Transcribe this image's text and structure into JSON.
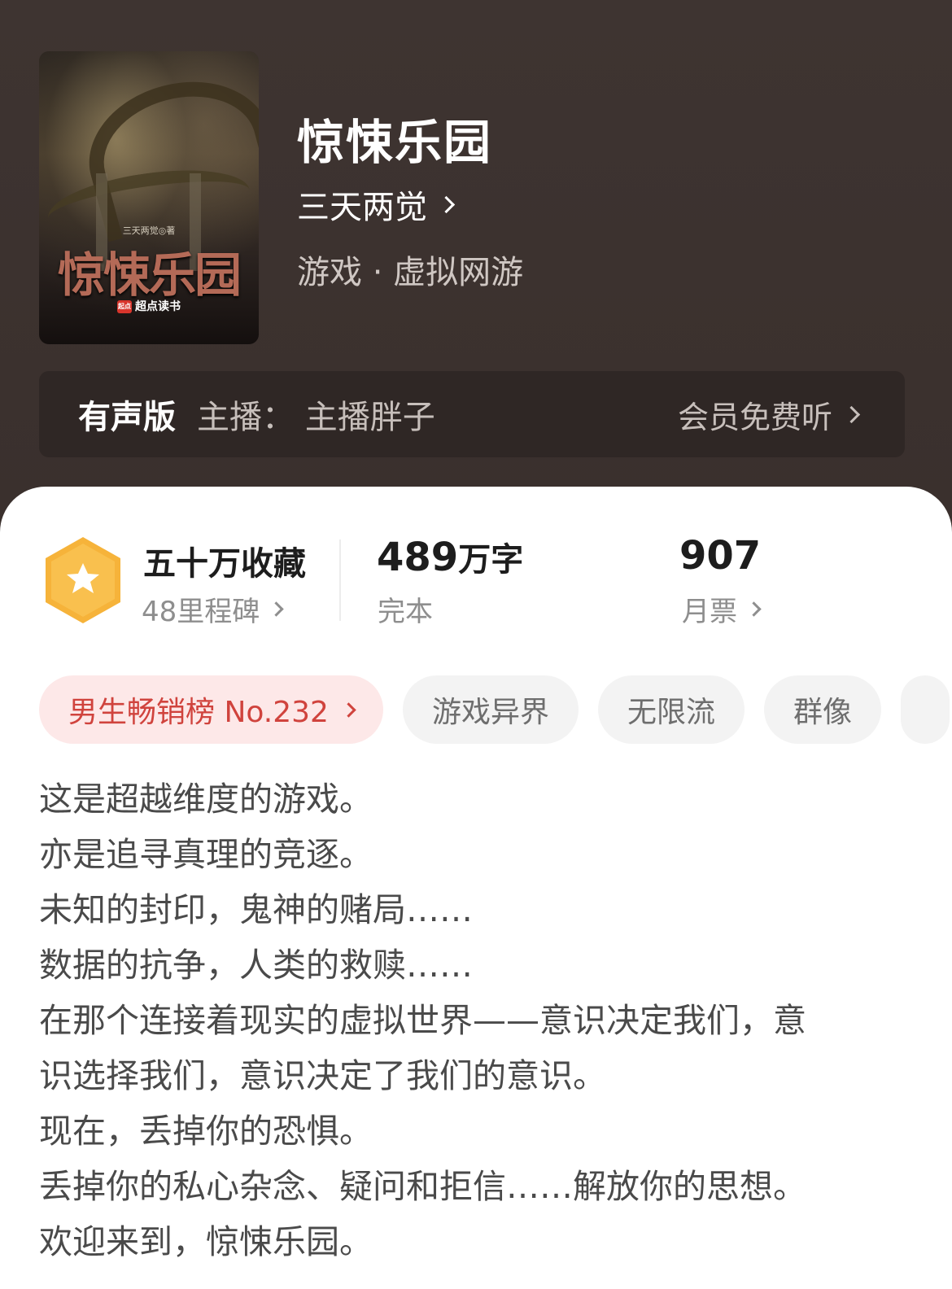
{
  "book": {
    "title": "惊悚乐园",
    "author": "三天两觉",
    "genre": "游戏 · 虚拟网游"
  },
  "cover": {
    "author_credit": "三天两觉◎著",
    "title": "惊悚乐园",
    "brand_logo": "起点",
    "brand": "超点读书"
  },
  "audio": {
    "label": "有声版",
    "host": "主播：  主播胖子",
    "link": "会员免费听"
  },
  "stats": {
    "collections": "五十万收藏",
    "milestones": "48里程碑",
    "words": "489",
    "words_unit": "万字",
    "status": "完本",
    "monthly_votes": "907",
    "monthly_votes_label": "月票"
  },
  "tags": [
    {
      "label": "男生畅销榜 No.232"
    },
    {
      "label": "游戏异界"
    },
    {
      "label": "无限流"
    },
    {
      "label": "群像"
    }
  ],
  "synopsis": [
    "这是超越维度的游戏。",
    "亦是追寻真理的竞逐。",
    "未知的封印，鬼神的赌局……",
    "数据的抗争，人类的救赎……",
    "在那个连接着现实的虚拟世界——意识决定我们，意",
    "识选择我们，意识决定了我们的意识。",
    "现在，丢掉你的恐惧。",
    "丢掉你的私心杂念、疑问和拒信……解放你的思想。",
    "欢迎来到，惊悚乐园。"
  ],
  "colors": {
    "header_bg": "#3a302d",
    "rank_tag_bg": "#fde8e8",
    "rank_tag_text": "#d0433d",
    "badge": "#f6b33a"
  }
}
